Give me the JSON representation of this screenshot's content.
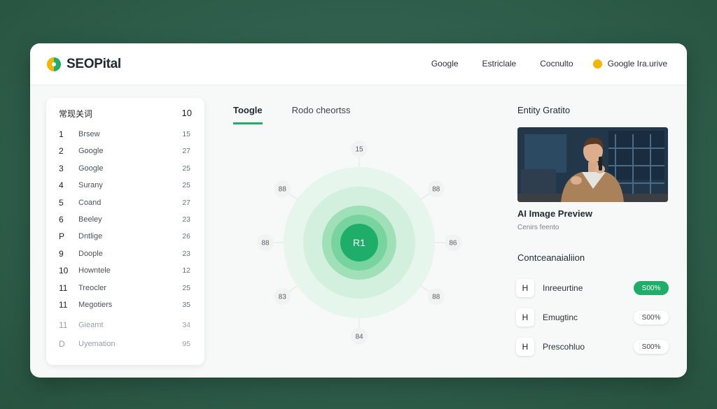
{
  "app": {
    "name": "SEOPital",
    "colors": {
      "accent": "#1fae6a",
      "logo_yellow": "#f4b400",
      "logo_green": "#1fae6a"
    }
  },
  "nav": {
    "items": [
      "Google",
      "Estriclale",
      "Cocnulto"
    ],
    "user_label": "Google Ira.urive"
  },
  "keywords": {
    "header_label": "常现关词",
    "header_count": "10",
    "rows": [
      {
        "rank": "1",
        "label": "Brsew",
        "value": "15"
      },
      {
        "rank": "2",
        "label": "Google",
        "value": "27"
      },
      {
        "rank": "3",
        "label": "Google",
        "value": "25"
      },
      {
        "rank": "4",
        "label": "Surany",
        "value": "25"
      },
      {
        "rank": "5",
        "label": "Coand",
        "value": "27"
      },
      {
        "rank": "6",
        "label": "Beeley",
        "value": "23"
      },
      {
        "rank": "P",
        "label": "Dntlige",
        "value": "26"
      },
      {
        "rank": "9",
        "label": "Doople",
        "value": "23"
      },
      {
        "rank": "10",
        "label": "Howntele",
        "value": "12"
      },
      {
        "rank": "11",
        "label": "Treocler",
        "value": "25"
      },
      {
        "rank": "11",
        "label": "Megotiers",
        "value": "35"
      },
      {
        "rank": "11",
        "label": "Gieamt",
        "value": "34"
      },
      {
        "rank": "D",
        "label": "Uyemation",
        "value": "95"
      }
    ]
  },
  "graph": {
    "tabs": [
      {
        "label": "Toogle",
        "active": true
      },
      {
        "label": "Rodo cheortss",
        "active": false
      }
    ],
    "center_label": "R1",
    "nodes": [
      {
        "label": "15",
        "angle": -90
      },
      {
        "label": "88",
        "angle": -35
      },
      {
        "label": "86",
        "angle": 0
      },
      {
        "label": "88",
        "angle": 35
      },
      {
        "label": "84",
        "angle": 90
      },
      {
        "label": "83",
        "angle": 145
      },
      {
        "label": "88",
        "angle": 180
      },
      {
        "label": "88",
        "angle": 215
      }
    ]
  },
  "entity": {
    "title": "Entity Gratito",
    "preview_title": "AI Image Preview",
    "preview_subtitle": "Cenirs feento"
  },
  "concentration": {
    "title": "Contceanaialiion",
    "rows": [
      {
        "badge": "H",
        "label": "Inreeurtine",
        "value": "S00%",
        "on": true
      },
      {
        "badge": "H",
        "label": "Emugtinc",
        "value": "S00%",
        "on": false
      },
      {
        "badge": "H",
        "label": "Prescohluo",
        "value": "S00%",
        "on": false
      }
    ]
  }
}
